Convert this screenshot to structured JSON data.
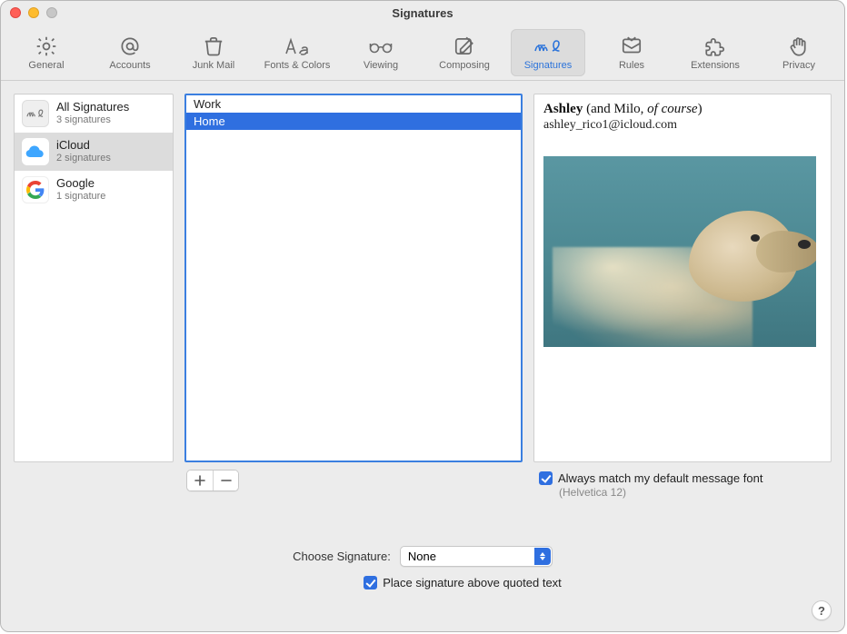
{
  "window": {
    "title": "Signatures"
  },
  "toolbar": {
    "items": [
      {
        "label": "General"
      },
      {
        "label": "Accounts"
      },
      {
        "label": "Junk Mail"
      },
      {
        "label": "Fonts & Colors"
      },
      {
        "label": "Viewing"
      },
      {
        "label": "Composing"
      },
      {
        "label": "Signatures"
      },
      {
        "label": "Rules"
      },
      {
        "label": "Extensions"
      },
      {
        "label": "Privacy"
      }
    ]
  },
  "accounts": [
    {
      "name": "All Signatures",
      "sub": "3 signatures"
    },
    {
      "name": "iCloud",
      "sub": "2 signatures"
    },
    {
      "name": "Google",
      "sub": "1 signature"
    }
  ],
  "signatures": {
    "items": [
      {
        "name": "Work"
      },
      {
        "name": "Home"
      }
    ]
  },
  "preview": {
    "name_bold": "Ashley",
    "name_rest": " (and Milo, ",
    "name_italic": "of course",
    "name_tail": ")",
    "email": "ashley_rico1@icloud.com"
  },
  "controls": {
    "match_font_label": "Always match my default message font",
    "match_font_sub": "(Helvetica 12)",
    "choose_label": "Choose Signature:",
    "choose_value": "None",
    "place_above_label": "Place signature above quoted text",
    "help_label": "?"
  }
}
